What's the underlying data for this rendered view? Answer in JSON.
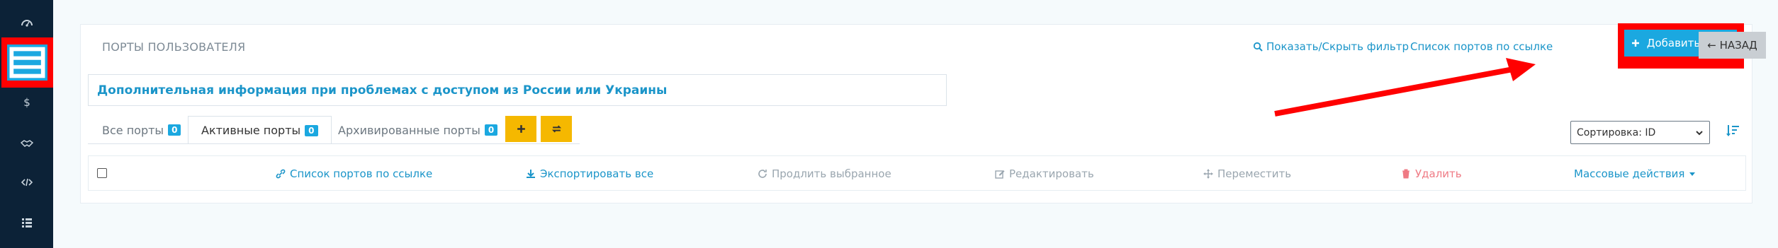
{
  "sidebar": {
    "items": [
      {
        "icon": "dashboard-icon"
      },
      {
        "icon": "ports-list-icon",
        "active": true
      },
      {
        "icon": "dollar-icon"
      },
      {
        "icon": "handshake-icon"
      },
      {
        "icon": "code-icon"
      },
      {
        "icon": "list-icon"
      }
    ]
  },
  "header": {
    "title": "ПОРТЫ ПОЛЬЗОВАТЕЛЯ",
    "toggle_filter_label": "Показать/Скрыть фильтр",
    "ports_by_link_label": "Список портов по ссылке",
    "add_port_label": "Добавить порт",
    "back_label": "← НАЗАД"
  },
  "info": {
    "text": "Дополнительная информация при проблемах с доступом из России или Украины"
  },
  "tabs": [
    {
      "label": "Все порты",
      "count": "0"
    },
    {
      "label": "Активные порты",
      "count": "0",
      "active": true
    },
    {
      "label": "Архивированные порты",
      "count": "0"
    }
  ],
  "sort": {
    "selected": "Сортировка: ID"
  },
  "actions": {
    "ports_by_link": "Список портов по ссылке",
    "export_all": "Экспортировать все",
    "renew_selected": "Продлить выбранное",
    "edit": "Редактировать",
    "move": "Переместить",
    "delete": "Удалить",
    "bulk_actions": "Массовые действия"
  },
  "colors": {
    "sidebar_bg": "#0c2237",
    "accent": "#1ba8e0",
    "link": "#1b95c9",
    "yellow": "#f5b800",
    "annotation_red": "#ff0000",
    "delete_red": "#ef7a84"
  }
}
